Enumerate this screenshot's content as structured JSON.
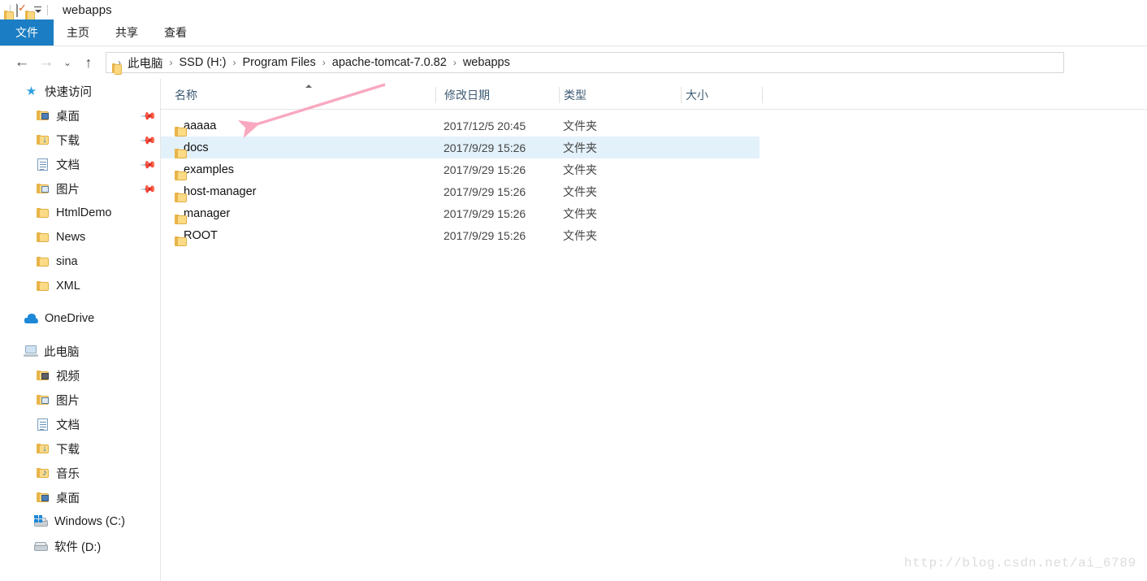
{
  "window": {
    "title": "webapps",
    "quick_access_toolbar": [
      {
        "name": "folder-properties-icon",
        "icon": "folder-mini"
      },
      {
        "name": "checked-document-icon",
        "icon": "doc-check"
      },
      {
        "name": "new-folder-icon",
        "icon": "folder-mini"
      },
      {
        "name": "customize-quick-access-toolbar",
        "icon": "caret-down"
      }
    ]
  },
  "ribbon": {
    "tabs": [
      {
        "label": "文件",
        "active": true
      },
      {
        "label": "主页",
        "active": false
      },
      {
        "label": "共享",
        "active": false
      },
      {
        "label": "查看",
        "active": false
      }
    ]
  },
  "navigation": {
    "back": "←",
    "forward": "→",
    "recent": "⌄",
    "up": "↑",
    "breadcrumb": [
      "此电脑",
      "SSD (H:)",
      "Program Files",
      "apache-tomcat-7.0.82",
      "webapps"
    ],
    "separator": "›"
  },
  "sidebar": {
    "groups": [
      {
        "name": "quick-access",
        "header": {
          "label": "快速访问",
          "icon": "star-icon"
        },
        "items": [
          {
            "label": "桌面",
            "icon": "folder-desktop-icon",
            "pinned": true
          },
          {
            "label": "下载",
            "icon": "folder-download-icon",
            "pinned": true
          },
          {
            "label": "文档",
            "icon": "document-icon",
            "pinned": true
          },
          {
            "label": "图片",
            "icon": "folder-pictures-icon",
            "pinned": true
          },
          {
            "label": "HtmlDemo",
            "icon": "folder-icon",
            "pinned": false
          },
          {
            "label": "News",
            "icon": "folder-icon",
            "pinned": false
          },
          {
            "label": "sina",
            "icon": "folder-icon",
            "pinned": false
          },
          {
            "label": "XML",
            "icon": "folder-icon",
            "pinned": false
          }
        ]
      },
      {
        "name": "onedrive",
        "header": {
          "label": "OneDrive",
          "icon": "cloud-icon"
        },
        "items": []
      },
      {
        "name": "this-pc",
        "header": {
          "label": "此电脑",
          "icon": "computer-icon"
        },
        "items": [
          {
            "label": "视频",
            "icon": "folder-videos-icon",
            "pinned": false
          },
          {
            "label": "图片",
            "icon": "folder-pictures-icon",
            "pinned": false
          },
          {
            "label": "文档",
            "icon": "document-icon",
            "pinned": false
          },
          {
            "label": "下载",
            "icon": "folder-download-icon",
            "pinned": false
          },
          {
            "label": "音乐",
            "icon": "folder-music-icon",
            "pinned": false
          },
          {
            "label": "桌面",
            "icon": "folder-desktop-icon",
            "pinned": false
          },
          {
            "label": "Windows (C:)",
            "icon": "drive-windows-icon",
            "pinned": false
          },
          {
            "label": "软件 (D:)",
            "icon": "drive-icon",
            "pinned": false
          }
        ]
      }
    ]
  },
  "columns": [
    {
      "label": "名称",
      "sorted": "asc"
    },
    {
      "label": "修改日期",
      "sorted": ""
    },
    {
      "label": "类型",
      "sorted": ""
    },
    {
      "label": "大小",
      "sorted": ""
    }
  ],
  "files": [
    {
      "name": "aaaaa",
      "date": "2017/12/5 20:45",
      "type": "文件夹",
      "size": "",
      "selected": false
    },
    {
      "name": "docs",
      "date": "2017/9/29 15:26",
      "type": "文件夹",
      "size": "",
      "selected": true
    },
    {
      "name": "examples",
      "date": "2017/9/29 15:26",
      "type": "文件夹",
      "size": "",
      "selected": false
    },
    {
      "name": "host-manager",
      "date": "2017/9/29 15:26",
      "type": "文件夹",
      "size": "",
      "selected": false
    },
    {
      "name": "manager",
      "date": "2017/9/29 15:26",
      "type": "文件夹",
      "size": "",
      "selected": false
    },
    {
      "name": "ROOT",
      "date": "2017/9/29 15:26",
      "type": "文件夹",
      "size": "",
      "selected": false
    }
  ],
  "annotation": {
    "arrow_color": "#f9a8c0",
    "points_to": "aaaaa"
  },
  "watermark": {
    "text": "http://blog.csdn.net/ai_6789"
  },
  "colors": {
    "accent": "#1b7dc4",
    "selection": "#e3f1fb",
    "header_text": "#3d5a73",
    "annotation_pink": "#f9a8c0"
  }
}
